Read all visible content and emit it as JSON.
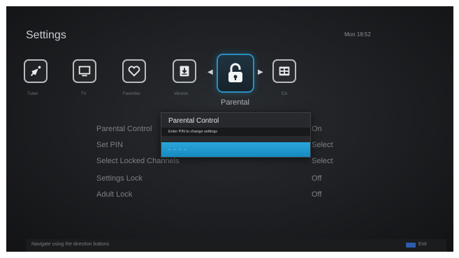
{
  "header": {
    "title": "Settings",
    "clock": "Mon 18:52"
  },
  "menu": {
    "items": [
      {
        "label": "Tuner",
        "icon": "satellite-dish-icon"
      },
      {
        "label": "TV",
        "icon": "tv-icon"
      },
      {
        "label": "Favorites",
        "icon": "heart-icon"
      },
      {
        "label": "Version",
        "icon": "download-icon"
      },
      {
        "label": "Parental",
        "icon": "lock-icon",
        "selected": true
      },
      {
        "label": "CA",
        "icon": "card-icon"
      }
    ]
  },
  "options": [
    {
      "label": "Parental Control",
      "value": "On"
    },
    {
      "label": "Set PIN",
      "value": "Select"
    },
    {
      "label": "Select Locked Channels",
      "value": "Select"
    },
    {
      "label": "Settings Lock",
      "value": "Off"
    },
    {
      "label": "Adult Lock",
      "value": "Off"
    }
  ],
  "dialog": {
    "title": "Parental Control",
    "subtitle": "Enter PIN to change settings",
    "pin_placeholder": "- - - -"
  },
  "footer": {
    "hint": "Navigate using the direction buttons",
    "exit_label": "Exit"
  },
  "colors": {
    "accent": "#1d9ad3",
    "background": "#1e2023",
    "exit_key": "#2c5cae"
  }
}
